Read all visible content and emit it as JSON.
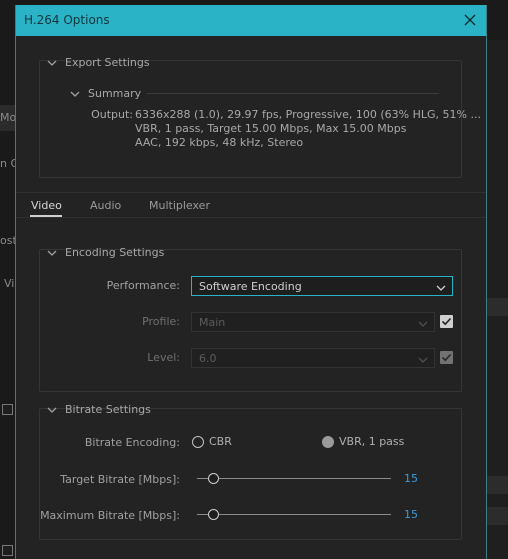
{
  "background": {
    "fragments": [
      "Mo",
      "n O",
      "ost",
      "Vi"
    ]
  },
  "dialog": {
    "title": "H.264 Options",
    "export_settings": {
      "heading": "Export Settings",
      "summary_heading": "Summary",
      "output_label": "Output:",
      "output_lines": [
        "6336x288 (1.0), 29.97 fps, Progressive, 100 (63% HLG, 51% ...",
        "VBR, 1 pass, Target 15.00 Mbps, Max 15.00 Mbps",
        "AAC, 192 kbps, 48 kHz, Stereo"
      ]
    },
    "tabs": [
      {
        "label": "Video",
        "active": true
      },
      {
        "label": "Audio",
        "active": false
      },
      {
        "label": "Multiplexer",
        "active": false
      }
    ],
    "encoding": {
      "heading": "Encoding Settings",
      "performance_label": "Performance:",
      "performance_value": "Software Encoding",
      "profile_label": "Profile:",
      "profile_value": "Main",
      "profile_checked": true,
      "level_label": "Level:",
      "level_value": "6.0",
      "level_checked": true
    },
    "bitrate": {
      "heading": "Bitrate Settings",
      "encoding_label": "Bitrate Encoding:",
      "option_cbr": "CBR",
      "option_vbr": "VBR, 1 pass",
      "selected_option": "VBR, 1 pass",
      "target_label": "Target Bitrate [Mbps]:",
      "target_value": "15",
      "target_fraction": 0.06,
      "max_label": "Maximum Bitrate [Mbps]:",
      "max_value": "15",
      "max_fraction": 0.06
    }
  },
  "colors": {
    "title_bar": "#2ab3c6",
    "focus": "#2ab3c6",
    "value_blue": "#3a9bd6"
  }
}
